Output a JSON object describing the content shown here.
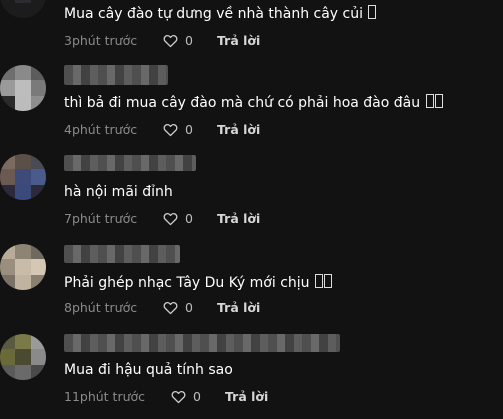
{
  "comments": [
    {
      "text": "Mua cây đào tự dưng về nhà thành cây củi",
      "glyphs": 1,
      "time": "3phút trước",
      "likes": "0",
      "reply": "Trả lời",
      "avatar_colors": [
        "#1c1c1c",
        "#2a2a2a",
        "#3a3a44",
        "#1c1c1c",
        "#2c2c30",
        "#1c1c1c",
        "#1c1c1c",
        "#1c1c1c",
        "#1c1c1c"
      ]
    },
    {
      "text": "thì bả đi mua cây đào mà chứ có phải hoa đào đâu",
      "glyphs": 2,
      "time": "4phút trước",
      "likes": "0",
      "reply": "Trả lời",
      "avatar_colors": [
        "#6e6e6e",
        "#8a8a8a",
        "#5c5c5c",
        "#9a9a9a",
        "#bdbdbd",
        "#7a7a7a",
        "#2a2a2a",
        "#bcbcbc",
        "#8e8e8e"
      ]
    },
    {
      "text": "hà nội mãi đỉnh",
      "glyphs": 0,
      "time": "7phút trước",
      "likes": "0",
      "reply": "Trả lời",
      "avatar_colors": [
        "#7a6a60",
        "#5a5048",
        "#4a4a52",
        "#6a5a52",
        "#3e4a7a",
        "#4a5a8a",
        "#2a2a3a",
        "#3a4a7a",
        "#2a2a3a"
      ]
    },
    {
      "text": "Phải ghép nhạc Tây Du Ký mới chịu",
      "glyphs": 2,
      "time": "8phút trước",
      "likes": "0",
      "reply": "Trả lời",
      "avatar_colors": [
        "#b8ab98",
        "#8e8474",
        "#6e6a60",
        "#9a8e7e",
        "#c8bca8",
        "#d4c8b4",
        "#7a7266",
        "#c0b4a0",
        "#8a8070"
      ]
    },
    {
      "text": "Mua đi hậu quả tính sao",
      "glyphs": 0,
      "time": "11phút trước",
      "likes": "0",
      "reply": "Trả lời",
      "avatar_colors": [
        "#5a5a40",
        "#7a7a48",
        "#9a9a9a",
        "#6a6a38",
        "#4a4a30",
        "#8a8a8a",
        "#5a5a5a",
        "#6a6a6a",
        "#4a4a4a"
      ]
    }
  ]
}
